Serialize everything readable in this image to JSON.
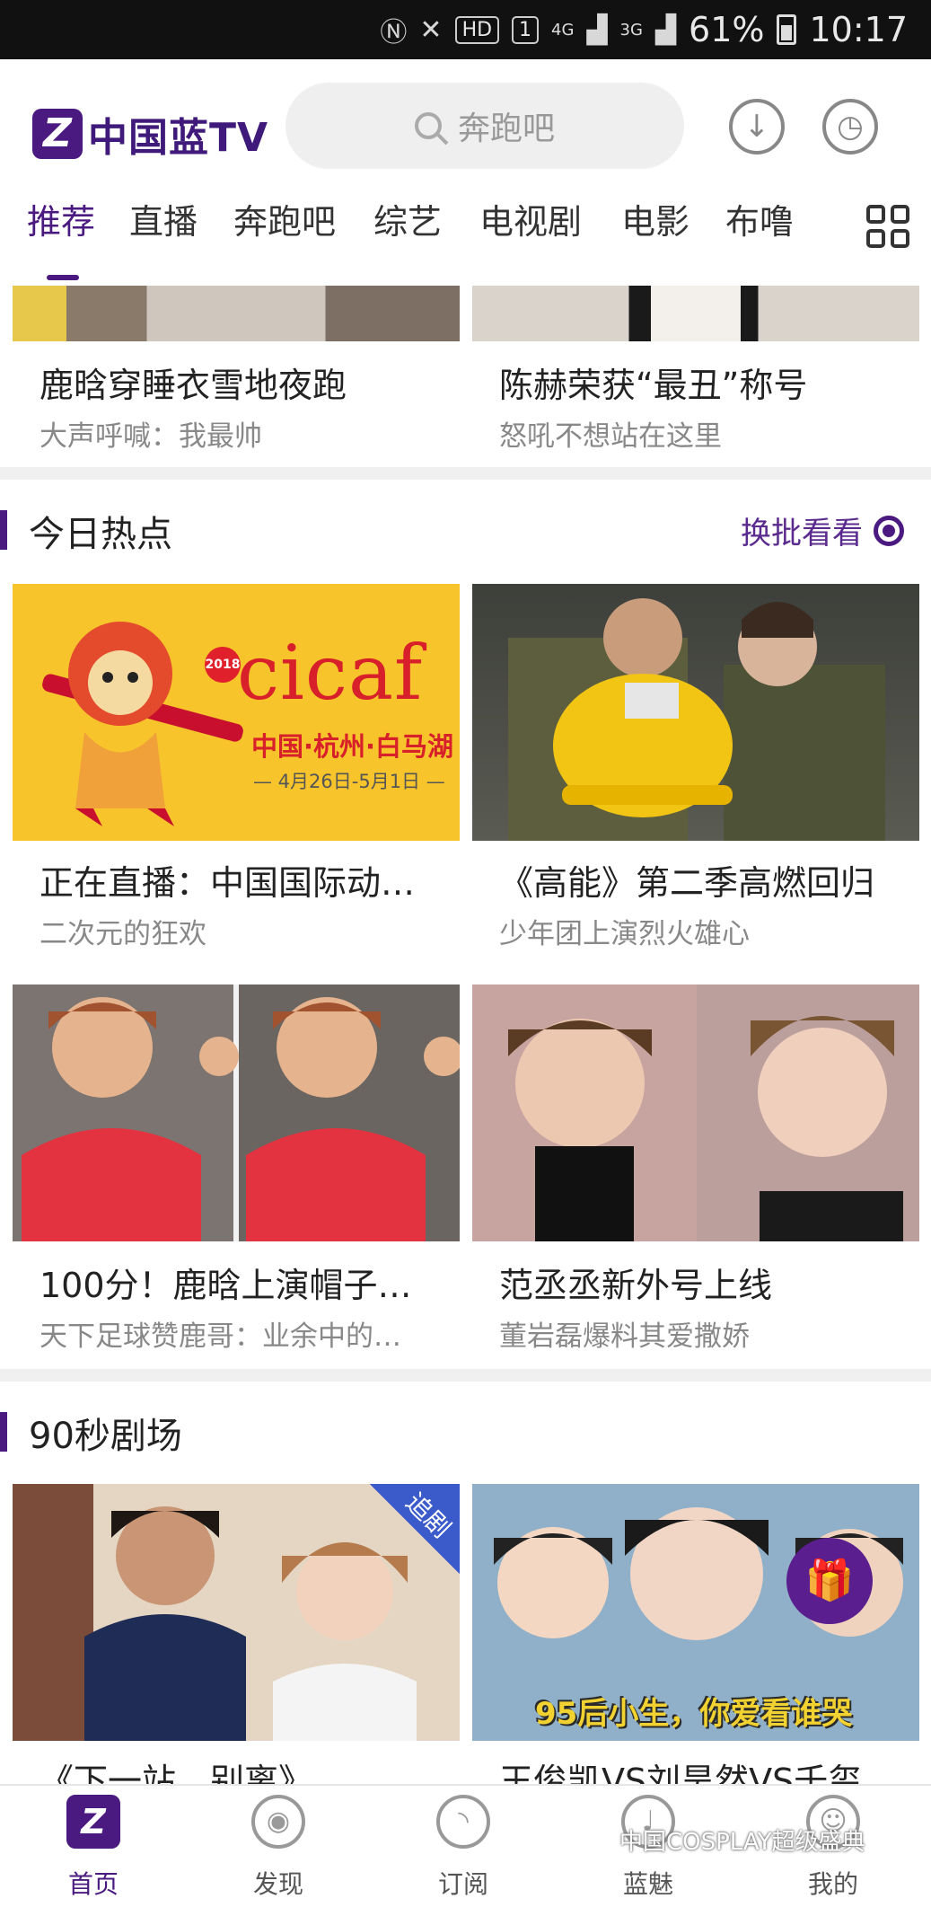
{
  "status_bar": {
    "hd": "HD",
    "sim": "1",
    "net1": "4G",
    "net2": "3G",
    "battery": "61%",
    "time": "10:17"
  },
  "header": {
    "logo_text": "中国蓝TV",
    "search_placeholder": "奔跑吧"
  },
  "tabs": [
    "推荐",
    "直播",
    "奔跑吧",
    "综艺",
    "电视剧",
    "电影",
    "布噜"
  ],
  "top_cards": [
    {
      "title": "鹿晗穿睡衣雪地夜跑",
      "subtitle": "大声呼喊：我最帅"
    },
    {
      "title": "陈赫荣获“最丑”称号",
      "subtitle": "怒吼不想站在这里"
    }
  ],
  "hot_section": {
    "title": "今日热点",
    "refresh_label": "换批看看",
    "cards": [
      {
        "title": "正在直播：中国国际动…",
        "subtitle": "二次元的狂欢",
        "image_text": {
          "year": "2018",
          "brand": "cicaf",
          "location": "中国·杭州·白马湖",
          "dates": "— 4月26日-5月1日 —"
        }
      },
      {
        "title": "《高能》第二季高燃回归",
        "subtitle": "少年团上演烈火雄心"
      },
      {
        "title": "100分！鹿晗上演帽子…",
        "subtitle": "天下足球赞鹿哥：业余中的…"
      },
      {
        "title": "范丞丞新外号上线",
        "subtitle": "董岩磊爆料其爱撒娇"
      }
    ]
  },
  "theater_section": {
    "title": "90秒剧场",
    "cards": [
      {
        "title": "《下一站，别离》",
        "tag": "追剧"
      },
      {
        "title": "王俊凯VS刘昊然VS千玺",
        "banner": "95后小生，你爱看谁哭"
      }
    ]
  },
  "bottom_nav": [
    {
      "label": "首页",
      "icon": "home-logo-icon"
    },
    {
      "label": "发现",
      "icon": "eye-icon"
    },
    {
      "label": "订阅",
      "icon": "rss-icon"
    },
    {
      "label": "蓝魅",
      "icon": "mic-icon"
    },
    {
      "label": "我的",
      "icon": "user-icon"
    }
  ],
  "watermark": "中国COSPLAY超级盛典",
  "colors": {
    "accent": "#4a1a80",
    "cicaf_bg": "#f7c52b",
    "cicaf_red": "#d8202a"
  }
}
